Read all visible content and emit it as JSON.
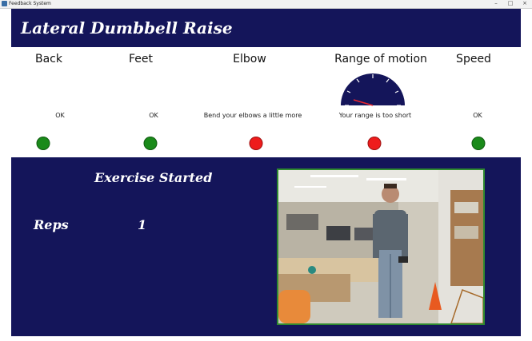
{
  "window": {
    "title": "Feedback System"
  },
  "header": {
    "exercise_name": "Lateral Dumbbell Raise"
  },
  "metrics": [
    {
      "label": "Back",
      "status": "OK",
      "light": "green"
    },
    {
      "label": "Feet",
      "status": "OK",
      "light": "green"
    },
    {
      "label": "Elbow",
      "status": "Bend your elbows a little more",
      "light": "red"
    },
    {
      "label": "Range of motion",
      "status": "Your range is too short",
      "light": "red"
    },
    {
      "label": "Speed",
      "status": "OK",
      "light": "green"
    }
  ],
  "gauge": {
    "icon": "range-gauge",
    "needle_color": "#e8252e"
  },
  "colors": {
    "navy": "#14155a",
    "green": "#1a8a1a",
    "red": "#ee1c1c",
    "frame": "#2f8a2f"
  },
  "session": {
    "status": "Exercise Started",
    "reps_label": "Reps",
    "reps_value": "1"
  }
}
